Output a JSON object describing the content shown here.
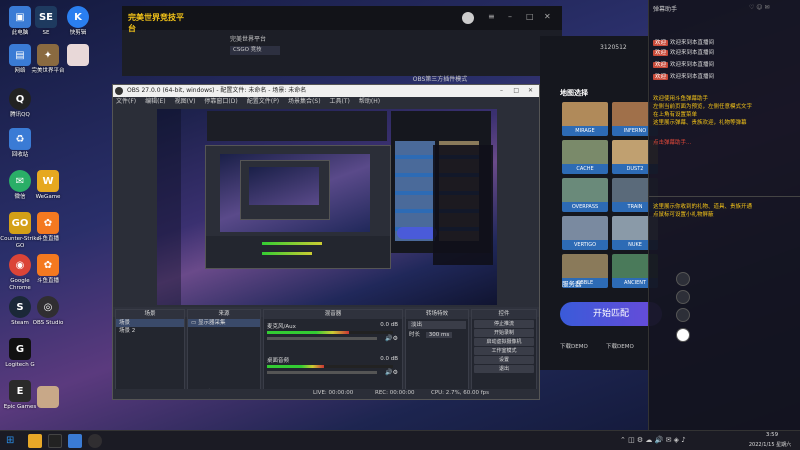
{
  "desktop": {
    "icons": [
      {
        "label": "此电脑",
        "color": "#3a7bd5",
        "glyph": "▣"
      },
      {
        "label": "SE",
        "color": "#1e3a5f",
        "glyph": "SE"
      },
      {
        "label": "快剪辑",
        "color": "#2a7ff0",
        "glyph": "K"
      },
      {
        "label": "网络",
        "color": "#3a7bd5",
        "glyph": "▤"
      },
      {
        "label": "完美世界平台",
        "color": "#8a6a40",
        "glyph": "✦"
      },
      {
        "label": "腾讯QQ",
        "color": "#222",
        "glyph": "Q"
      },
      {
        "label": "回收站",
        "color": "#3a7bd5",
        "glyph": "♻"
      },
      {
        "label": "WeGame",
        "color": "#e6a820",
        "glyph": "W"
      },
      {
        "label": "微信",
        "color": "#2aae67",
        "glyph": "✉"
      },
      {
        "label": "Counter-Strike GO",
        "color": "#d4a017",
        "glyph": "GO"
      },
      {
        "label": "斗鱼直播",
        "color": "#f47920",
        "glyph": "✿"
      },
      {
        "label": "Google Chrome",
        "color": "#db4437",
        "glyph": "◉"
      },
      {
        "label": "Steam",
        "color": "#1b2838",
        "glyph": "S"
      },
      {
        "label": "OBS Studio",
        "color": "#302e31",
        "glyph": "◎"
      },
      {
        "label": "Logitech G",
        "color": "#111",
        "glyph": "G"
      },
      {
        "label": "Epic Games",
        "color": "#2a2a2a",
        "glyph": "E"
      }
    ]
  },
  "game": {
    "app_name": "完美世界竞技平台",
    "title": "完美世界平台",
    "room_tag": "CSGO 竞技",
    "matching_mode_label": "OBS第三方插件模式",
    "map_section_title": "地图选择",
    "maps": [
      {
        "name": "MIRAGE",
        "color": "#b08a5a"
      },
      {
        "name": "INFERNO",
        "color": "#a0704a"
      },
      {
        "name": "CACHE",
        "color": "#7a8a6a"
      },
      {
        "name": "DUST2",
        "color": "#c0a070"
      },
      {
        "name": "OVERPASS",
        "color": "#6a8a7a"
      },
      {
        "name": "TRAIN",
        "color": "#5a6a7a"
      },
      {
        "name": "VERTIGO",
        "color": "#7a8aa0"
      },
      {
        "name": "NUKE",
        "color": "#8a9aa8"
      },
      {
        "name": "CBBLE",
        "color": "#8a7a5a"
      },
      {
        "name": "ANCIENT",
        "color": "#4a7a5a"
      }
    ],
    "server_label": "服务器",
    "start_button": "开始匹配",
    "download_btn1": "下载DEMO",
    "download_btn2": "下载DEMO",
    "counter": "3120512"
  },
  "obs": {
    "title": "OBS 27.0.0 (64-bit, windows) - 配置文件: 未命名 - 场景: 未命名",
    "menu": [
      "文件(F)",
      "编辑(E)",
      "视图(V)",
      "停靠窗口(D)",
      "配置文件(P)",
      "场景集合(S)",
      "工具(T)",
      "帮助(H)"
    ],
    "scenes_title": "场景",
    "scenes": [
      "场景",
      "场景 2"
    ],
    "sources_title": "来源",
    "sources": [
      "显示器采集"
    ],
    "mixer_title": "混音器",
    "mixer": [
      {
        "name": "麦克风/Aux",
        "db": "0.0 dB",
        "level": 0.65
      },
      {
        "name": "桌面音频",
        "db": "0.0 dB",
        "level": 0.45
      }
    ],
    "transitions_title": "转场特效",
    "transition_value": "淡出",
    "duration_label": "时长",
    "duration_value": "300 ms",
    "controls_title": "控件",
    "controls": [
      "停止推流",
      "开始录制",
      "启动虚拟摄像机",
      "工作室模式",
      "设置",
      "退出"
    ],
    "source_toolbar": [
      "属性",
      "滤镜"
    ],
    "status": {
      "live": "LIVE: 00:00:00",
      "rec": "REC: 00:00:00",
      "cpu": "CPU: 2.7%, 60.00 fps"
    }
  },
  "chat": {
    "title": "弹幕助手",
    "messages": [
      {
        "tag": "欢迎",
        "tag_color": "#c94a3a",
        "text": "欢迎来到本直播间"
      },
      {
        "tag": "欢迎",
        "tag_color": "#c94a3a",
        "text": "欢迎来到本直播间"
      },
      {
        "tag": "欢迎",
        "tag_color": "#c94a3a",
        "text": "欢迎来到本直播间"
      },
      {
        "tag": "欢迎",
        "tag_color": "#c94a3a",
        "text": "欢迎来到本直播间"
      }
    ],
    "notice_lines": [
      "欢迎使用斗鱼弹幕助手",
      "左侧当前页面为预览，左侧任意模式文字",
      "在上角有设置菜单",
      "这里展示弹幕、贵族欢迎，礼物等弹幕",
      "点击弹幕助手..."
    ],
    "notice_bottom": [
      "这里展示你收到的礼物、道具、贵族开通",
      "点鼠标可设置小礼物屏蔽"
    ]
  },
  "taskbar": {
    "time": "3:59",
    "date": "2022/1/15 星期六"
  }
}
